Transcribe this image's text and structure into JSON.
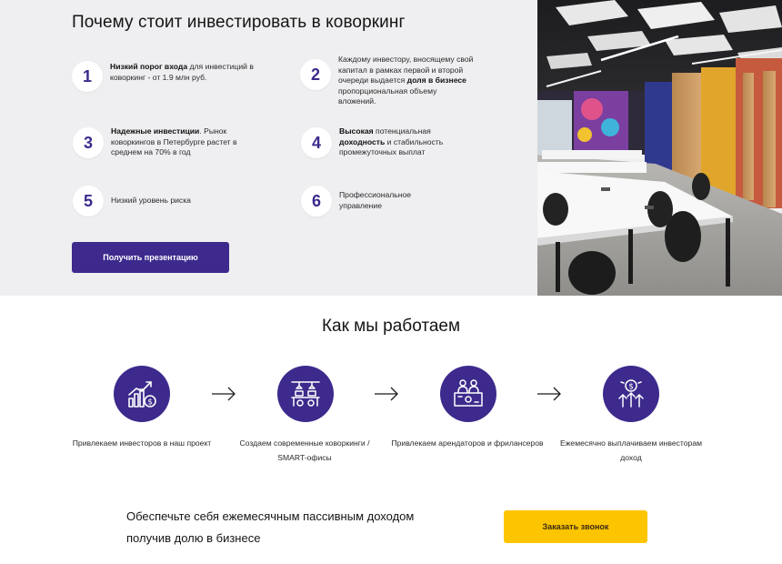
{
  "invest": {
    "title": "Почему стоит инвестировать в коворкинг",
    "benefits": [
      {
        "num": "1",
        "bold": "Низкий порог входа",
        "rest": " для инвестиций в коворкинг - от 1.9 млн руб."
      },
      {
        "num": "2",
        "pre": "Каждому инвестору, вносящему свой капитал в рамках первой и второй очереди выдается ",
        "bold": "доля в бизнесе",
        "rest": " пропорциональная объему вложений."
      },
      {
        "num": "3",
        "bold": "Надежные инвестиции",
        "rest": ". Рынок коворкингов в Петербурге растет в среднем на 70% в год"
      },
      {
        "num": "4",
        "bold": "Высокая",
        "rest": " потенциальная ",
        "bold2": "доходность",
        "rest2": " и стабильность промежуточных выплат"
      },
      {
        "num": "5",
        "text": "Низкий уровень риска"
      },
      {
        "num": "6",
        "text": "Профессиональное управление"
      }
    ],
    "cta_label": "Получить презентацию"
  },
  "how": {
    "title": "Как мы работаем",
    "steps": [
      {
        "label": "Привлекаем инвесторов в наш проект",
        "icon": "growth-chart-icon"
      },
      {
        "label": "Создаем современные коворкинги / SMART-офисы",
        "icon": "coworking-desk-icon"
      },
      {
        "label": "Привлекаем арендаторов и фрилансеров",
        "icon": "tenants-icon"
      },
      {
        "label": "Ежемесячно выплачиваем инвесторам доход",
        "icon": "income-icon"
      }
    ]
  },
  "bottom": {
    "text": "Обеспечьте себя ежемесячным пассивным доходом получив долю в бизнесе",
    "call_label": "Заказать звонок"
  },
  "colors": {
    "brand": "#3d2a8c",
    "accent": "#fdc500",
    "panel": "#efeef0"
  }
}
